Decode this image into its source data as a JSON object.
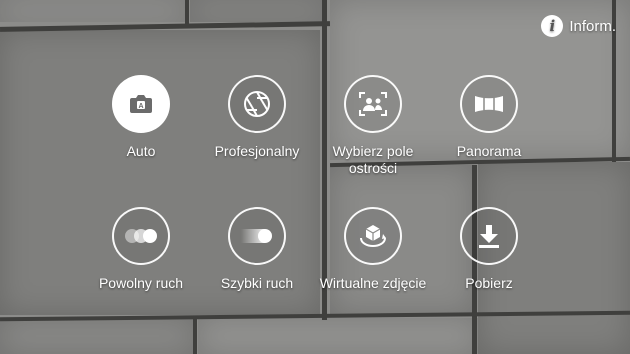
{
  "info": {
    "label": "Inform.",
    "icon": "info-icon"
  },
  "modes": [
    {
      "label": "Auto",
      "icon": "camera-auto-icon",
      "selected": true
    },
    {
      "label": "Profesjonalny",
      "icon": "aperture-icon",
      "selected": false
    },
    {
      "label": "Wybierz pole ostrości",
      "icon": "focus-select-icon",
      "selected": false
    },
    {
      "label": "Panorama",
      "icon": "panorama-icon",
      "selected": false
    },
    {
      "label": "Powolny ruch",
      "icon": "slow-motion-icon",
      "selected": false
    },
    {
      "label": "Szybki ruch",
      "icon": "hyperlapse-icon",
      "selected": false
    },
    {
      "label": "Wirtualne zdjęcie",
      "icon": "virtual-shot-icon",
      "selected": false
    },
    {
      "label": "Pobierz",
      "icon": "download-icon",
      "selected": false
    }
  ]
}
